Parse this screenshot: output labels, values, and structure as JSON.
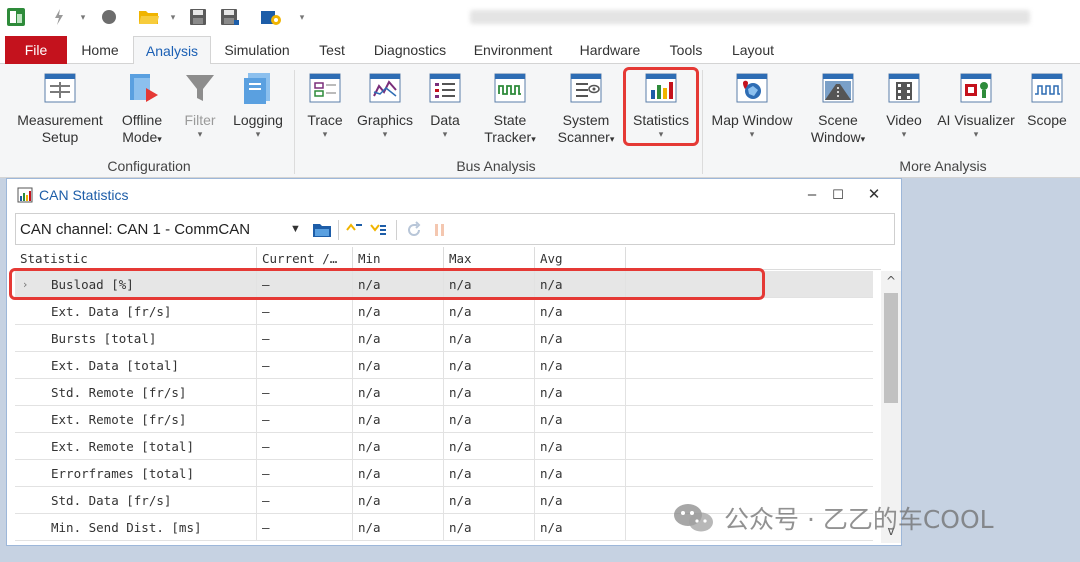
{
  "tabs": [
    "File",
    "Home",
    "Analysis",
    "Simulation",
    "Test",
    "Diagnostics",
    "Environment",
    "Hardware",
    "Tools",
    "Layout"
  ],
  "active_tab": "Analysis",
  "ribbon": {
    "configuration": {
      "group_label": "Configuration",
      "measurement_setup": [
        "Measurement",
        "Setup"
      ],
      "offline_mode": [
        "Offline",
        "Mode"
      ],
      "filter": "Filter",
      "logging": "Logging"
    },
    "bus_analysis": {
      "group_label": "Bus Analysis",
      "trace": "Trace",
      "graphics": "Graphics",
      "data": "Data",
      "state_tracker": [
        "State",
        "Tracker"
      ],
      "system_scanner": [
        "System",
        "Scanner"
      ],
      "statistics": "Statistics"
    },
    "more_analysis": {
      "group_label": "More Analysis",
      "map_window": "Map Window",
      "scene_window": [
        "Scene",
        "Window"
      ],
      "video": "Video",
      "ai_visualizer": "AI Visualizer",
      "scope": "Scope"
    },
    "dropdown_arrow": "▾"
  },
  "window": {
    "title": "CAN Statistics",
    "minimize": "–",
    "maximize": "☐",
    "close": "✕"
  },
  "channel_selector": {
    "label": "CAN channel: CAN 1 - CommCAN",
    "arrow": "▼"
  },
  "table": {
    "columns": [
      "Statistic",
      "Current /…",
      "Min",
      "Max",
      "Avg"
    ],
    "rows": [
      {
        "statistic": "Busload [%]",
        "current": "–",
        "min": "n/a",
        "max": "n/a",
        "avg": "n/a"
      },
      {
        "statistic": "Ext. Data [fr/s]",
        "current": "–",
        "min": "n/a",
        "max": "n/a",
        "avg": "n/a"
      },
      {
        "statistic": "Bursts [total]",
        "current": "–",
        "min": "n/a",
        "max": "n/a",
        "avg": "n/a"
      },
      {
        "statistic": "Ext. Data [total]",
        "current": "–",
        "min": "n/a",
        "max": "n/a",
        "avg": "n/a"
      },
      {
        "statistic": "Std. Remote [fr/s]",
        "current": "–",
        "min": "n/a",
        "max": "n/a",
        "avg": "n/a"
      },
      {
        "statistic": "Ext. Remote [fr/s]",
        "current": "–",
        "min": "n/a",
        "max": "n/a",
        "avg": "n/a"
      },
      {
        "statistic": "Ext. Remote [total]",
        "current": "–",
        "min": "n/a",
        "max": "n/a",
        "avg": "n/a"
      },
      {
        "statistic": "Errorframes [total]",
        "current": "–",
        "min": "n/a",
        "max": "n/a",
        "avg": "n/a"
      },
      {
        "statistic": "Std. Data [fr/s]",
        "current": "–",
        "min": "n/a",
        "max": "n/a",
        "avg": "n/a"
      },
      {
        "statistic": "Min. Send Dist. [ms]",
        "current": "–",
        "min": "n/a",
        "max": "n/a",
        "avg": "n/a"
      }
    ],
    "expand_glyph": "›"
  },
  "scrollbar": {
    "up": "^",
    "down": "v"
  },
  "watermark": "公众号 · 乙乙的车COOL",
  "colors": {
    "file_tab": "#c4121d",
    "accent_blue": "#1d5da8",
    "highlight_red": "#e53935",
    "selected_row": "#e6e6e6"
  }
}
